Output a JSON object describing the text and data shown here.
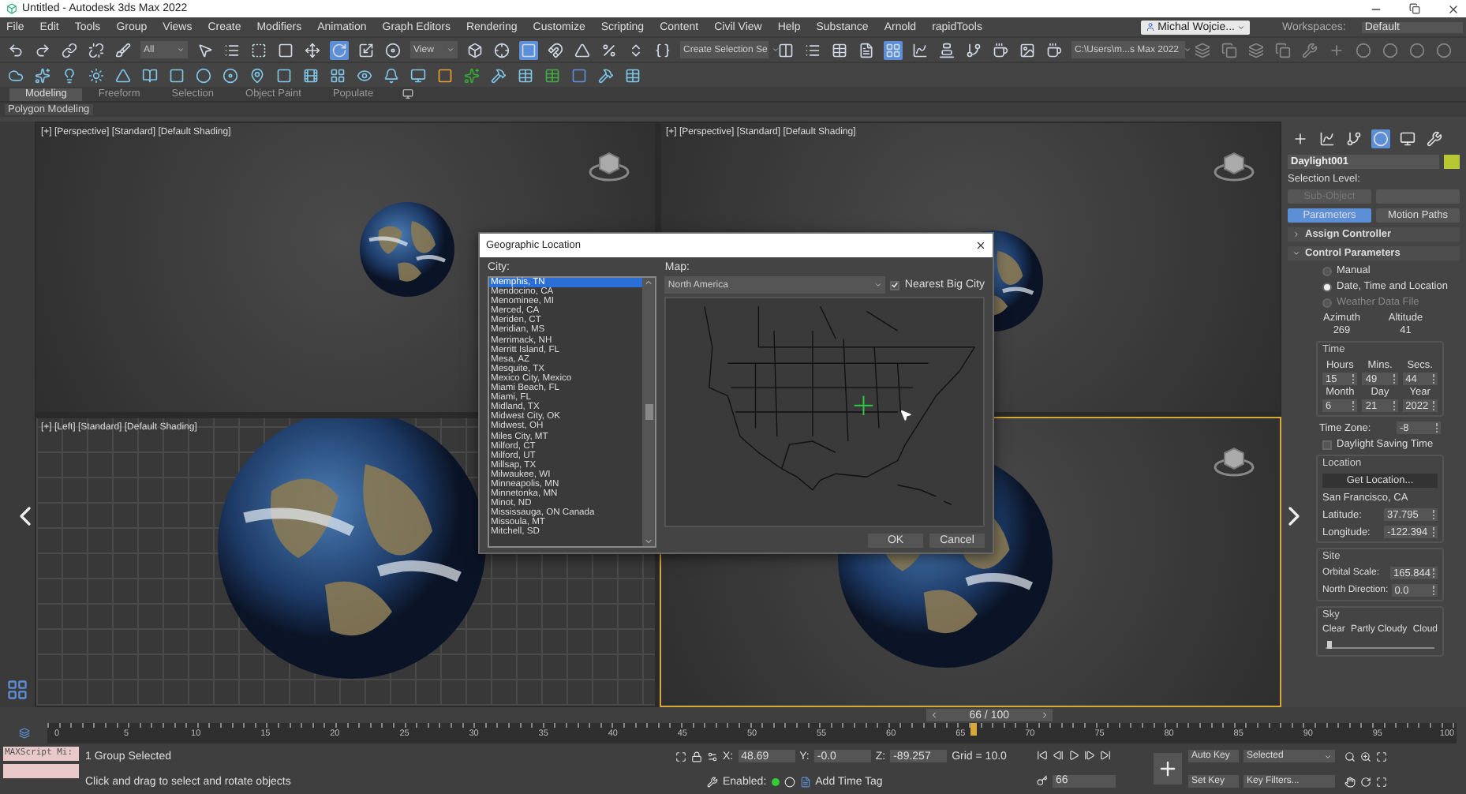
{
  "window": {
    "title": "Untitled - Autodesk 3ds Max 2022"
  },
  "menu": [
    "File",
    "Edit",
    "Tools",
    "Group",
    "Views",
    "Create",
    "Modifiers",
    "Animation",
    "Graph Editors",
    "Rendering",
    "Customize",
    "Scripting",
    "Content",
    "Civil View",
    "Help",
    "Substance",
    "Arnold",
    "rapidTools"
  ],
  "toolbar": {
    "selection_filter": "All",
    "reference_coord": "View",
    "named_selection": "Create Selection Se",
    "project_path": "C:\\Users\\m...s Max 2022",
    "user": "Michal Wojcie...",
    "workspaces_label": "Workspaces:",
    "workspace": "Default"
  },
  "ribbon": {
    "tabs": [
      {
        "label": "Modeling",
        "selected": true
      },
      {
        "label": "Freeform",
        "selected": false
      },
      {
        "label": "Selection",
        "selected": false
      },
      {
        "label": "Object Paint",
        "selected": false
      },
      {
        "label": "Populate",
        "selected": false
      }
    ],
    "panel": "Polygon Modeling"
  },
  "viewports": [
    {
      "label": "[+] [Perspective] [Standard] [Default Shading]",
      "kind": "perspective",
      "active": false
    },
    {
      "label": "[+] [Perspective] [Standard] [Default Shading]",
      "kind": "perspective",
      "active": false
    },
    {
      "label": "[+] [Left] [Standard] [Default Shading]",
      "kind": "grid",
      "active": false
    },
    {
      "kind": "perspective",
      "active": true
    }
  ],
  "dialog": {
    "title": "Geographic Location",
    "city_label": "City:",
    "map_label": "Map:",
    "map": "North America",
    "nearest_big_city": {
      "label": "Nearest Big City",
      "checked": true
    },
    "cities": [
      {
        "name": "Memphis, TN",
        "selected": true
      },
      {
        "name": "Mendocino, CA",
        "selected": false
      },
      {
        "name": "Menominee, MI",
        "selected": false
      },
      {
        "name": "Merced, CA",
        "selected": false
      },
      {
        "name": "Meriden, CT",
        "selected": false
      },
      {
        "name": "Meridian, MS",
        "selected": false
      },
      {
        "name": "Merrimack, NH",
        "selected": false
      },
      {
        "name": "Merritt Island, FL",
        "selected": false
      },
      {
        "name": "Mesa, AZ",
        "selected": false
      },
      {
        "name": "Mesquite, TX",
        "selected": false
      },
      {
        "name": "Mexico City, Mexico",
        "selected": false
      },
      {
        "name": "Miami Beach, FL",
        "selected": false
      },
      {
        "name": "Miami, FL",
        "selected": false
      },
      {
        "name": "Midland, TX",
        "selected": false
      },
      {
        "name": "Midwest City, OK",
        "selected": false
      },
      {
        "name": "Midwest, OH",
        "selected": false
      },
      {
        "name": "Miles City, MT",
        "selected": false
      },
      {
        "name": "Milford, CT",
        "selected": false
      },
      {
        "name": "Milford, UT",
        "selected": false
      },
      {
        "name": "Millsap, TX",
        "selected": false
      },
      {
        "name": "Milwaukee, WI",
        "selected": false
      },
      {
        "name": "Minneapolis, MN",
        "selected": false
      },
      {
        "name": "Minnetonka, MN",
        "selected": false
      },
      {
        "name": "Minot, ND",
        "selected": false
      },
      {
        "name": "Mississauga, ON Canada",
        "selected": false
      },
      {
        "name": "Missoula, MT",
        "selected": false
      },
      {
        "name": "Mitchell, SD",
        "selected": false
      }
    ],
    "buttons": [
      "OK",
      "Cancel"
    ]
  },
  "panel": {
    "object_name": "Daylight001",
    "selection_level_label": "Selection Level:",
    "sub_object": {
      "label": "Sub-Object",
      "disabled": true
    },
    "modes": [
      {
        "label": "Parameters",
        "selected": true
      },
      {
        "label": "Motion Paths",
        "selected": false
      }
    ],
    "rollouts": [
      {
        "title": "Assign Controller",
        "expanded": false
      },
      {
        "title": "Control Parameters",
        "expanded": true
      }
    ],
    "radios": [
      {
        "label": "Manual",
        "selected": false,
        "disabled": false
      },
      {
        "label": "Date, Time and Location",
        "selected": true,
        "disabled": false
      },
      {
        "label": "Weather Data File",
        "selected": false,
        "disabled": true
      }
    ],
    "azimuth": {
      "label": "Azimuth",
      "value": "269"
    },
    "altitude": {
      "label": "Altitude",
      "value": "41"
    },
    "time_title": "Time",
    "time_fields": [
      {
        "label": "Hours",
        "value": "15"
      },
      {
        "label": "Mins.",
        "value": "49"
      },
      {
        "label": "Secs.",
        "value": "44"
      },
      {
        "label": "Month",
        "value": "6"
      },
      {
        "label": "Day",
        "value": "21"
      },
      {
        "label": "Year",
        "value": "2022"
      }
    ],
    "time_zone": {
      "label": "Time Zone:",
      "value": "-8"
    },
    "daylight_saving": {
      "label": "Daylight Saving Time",
      "checked": false
    },
    "location_title": "Location",
    "get_location": "Get Location...",
    "city": "San Francisco, CA",
    "location_fields": [
      {
        "label": "Latitude:",
        "value": "37.795"
      },
      {
        "label": "Longitude:",
        "value": "-122.394"
      }
    ],
    "site_title": "Site",
    "site_fields": [
      {
        "label": "Orbital Scale:",
        "value": "165.844"
      },
      {
        "label": "North Direction:",
        "value": "0.0"
      }
    ],
    "sky": {
      "title": "Sky",
      "labels": [
        "Clear",
        "Partly Cloudy",
        "Cloud"
      ],
      "level": 0.02
    }
  },
  "timeline": {
    "frame": "66 / 100",
    "level": 0.66,
    "ticks": [
      "0",
      "5",
      "10",
      "15",
      "20",
      "25",
      "30",
      "35",
      "40",
      "45",
      "50",
      "55",
      "60",
      "65",
      "70",
      "75",
      "80",
      "85",
      "90",
      "95",
      "100"
    ]
  },
  "status": {
    "maxscript": "MAXScript Mi:",
    "selection": "1 Group Selected",
    "prompt": "Click and drag to select and rotate objects",
    "coords": [
      {
        "label": "X:",
        "value": "48.69"
      },
      {
        "label": "Y:",
        "value": "-0.0"
      },
      {
        "label": "Z:",
        "value": "-89.257"
      }
    ],
    "grid": "Grid = 10.0",
    "enabled": "Enabled:",
    "add_time_tag": "Add Time Tag",
    "frame": "66",
    "auto_key": "Auto Key",
    "key_mode": "Selected",
    "set_key": "Set Key",
    "key_filters": "Key Filters..."
  }
}
